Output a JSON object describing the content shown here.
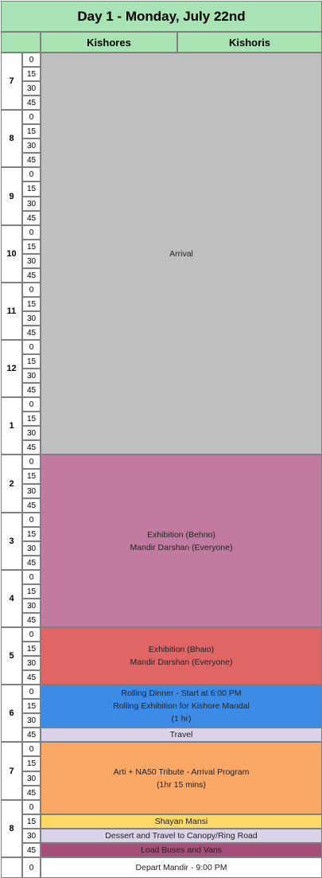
{
  "title": "Day 1 - Monday, July 22nd",
  "columns": [
    "Kishores",
    "Kishoris"
  ],
  "hours": [
    "7",
    "8",
    "9",
    "10",
    "11",
    "12",
    "1",
    "2",
    "3",
    "4",
    "5",
    "6",
    "7",
    "8"
  ],
  "minutes": [
    "0",
    "15",
    "30",
    "45"
  ],
  "final_minute": "0",
  "events": [
    {
      "lines": [
        "Arrival"
      ],
      "color": "#bfbfbf"
    },
    {
      "lines": [
        "Exhibition (Behno)",
        "Mandir Darshan (Everyone)"
      ],
      "color": "#c27ba0"
    },
    {
      "lines": [
        "Exhibition (Bhaio)",
        "Mandir Darshan (Everyone)"
      ],
      "color": "#e06666"
    },
    {
      "lines": [
        "Rolling Dinner - Start at 6:00 PM",
        "Rolling Exhibition for Kishore Mandal",
        "(1 hr)"
      ],
      "color": "#3c8ce7"
    },
    {
      "lines": [
        "Travel"
      ],
      "color": "#d9d2e9"
    },
    {
      "lines": [
        "Arti + NA50 Tribute - Arrival Program",
        "(1hr 15 mins)"
      ],
      "color": "#fba765"
    },
    {
      "lines": [
        "Shayan Mansi"
      ],
      "color": "#ffd966"
    },
    {
      "lines": [
        "Dessert and Travel to Canopy/Ring Road"
      ],
      "color": "#d9d2e9"
    },
    {
      "lines": [
        "Load Buses and Vans"
      ],
      "color": "#a64d79"
    },
    {
      "lines": [
        "Depart Mandir - 9:00 PM"
      ],
      "color": "#ffffff"
    }
  ]
}
